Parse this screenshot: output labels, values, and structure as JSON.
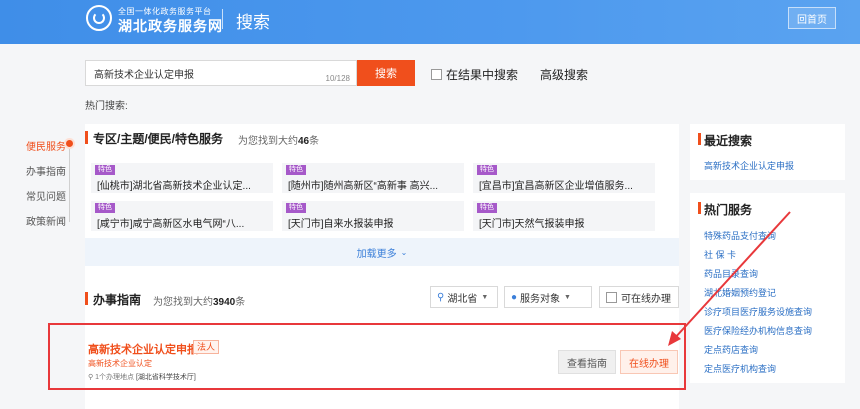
{
  "header": {
    "logo_sub": "全国一体化政务服务平台",
    "logo_main": "湖北政务服务网",
    "title": "搜索",
    "home_label": "回首页"
  },
  "search": {
    "value": "高新技术企业认定申报",
    "count": "10/128",
    "button": "搜索",
    "in_result": "在结果中搜索",
    "advanced": "高级搜索",
    "hot_label": "热门搜索:"
  },
  "left_nav": {
    "items": [
      {
        "label": "便民服务"
      },
      {
        "label": "办事指南"
      },
      {
        "label": "常见问题"
      },
      {
        "label": "政策新闻"
      }
    ]
  },
  "special": {
    "title": "专区/主题/便民/特色服务",
    "count_prefix": "为您找到大约",
    "count": "46",
    "count_suffix": "条",
    "cards": [
      {
        "tag": "特色",
        "text": "[仙桃市]湖北省高新技术企业认定..."
      },
      {
        "tag": "特色",
        "text": "[随州市]随州高新区“高新事 高兴..."
      },
      {
        "tag": "特色",
        "text": "[宜昌市]宜昌高新区企业增值服务..."
      },
      {
        "tag": "特色",
        "text": "[咸宁市]咸宁高新区水电气网“八..."
      },
      {
        "tag": "特色",
        "text": "[天门市]自来水报装申报"
      },
      {
        "tag": "特色",
        "text": "[天门市]天然气报装申报"
      }
    ],
    "load_more": "加载更多"
  },
  "guide": {
    "title": "办事指南",
    "count_prefix": "为您找到大约",
    "count": "3940",
    "count_suffix": "条",
    "filter_region": "湖北省",
    "filter_target": "服务对象",
    "filter_online": "可在线办理",
    "result": {
      "title": "高新技术企业认定申报",
      "tag": "法人",
      "subtitle": "高新技术企业认定",
      "meta_count": "1个办理地点",
      "meta_dept": "[湖北省科学技术厅]",
      "btn_guide": "查看指南",
      "btn_online": "在线办理"
    }
  },
  "recent": {
    "title": "最近搜索",
    "items": [
      "高新技术企业认定申报"
    ]
  },
  "hot_services": {
    "title": "热门服务",
    "items": [
      "特殊药品支付查询",
      "社 保 卡",
      "药品目录查询",
      "湖北婚姻预约登记",
      "诊疗项目医疗服务设施查询",
      "医疗保险经办机构信息查询",
      "定点药店查询",
      "定点医疗机构查询"
    ]
  },
  "colors": {
    "accent": "#f04f1c",
    "header": "#4d99ee",
    "link": "#2b6fc4",
    "tag": "#a659c9",
    "highlight_box": "#e8383b"
  }
}
